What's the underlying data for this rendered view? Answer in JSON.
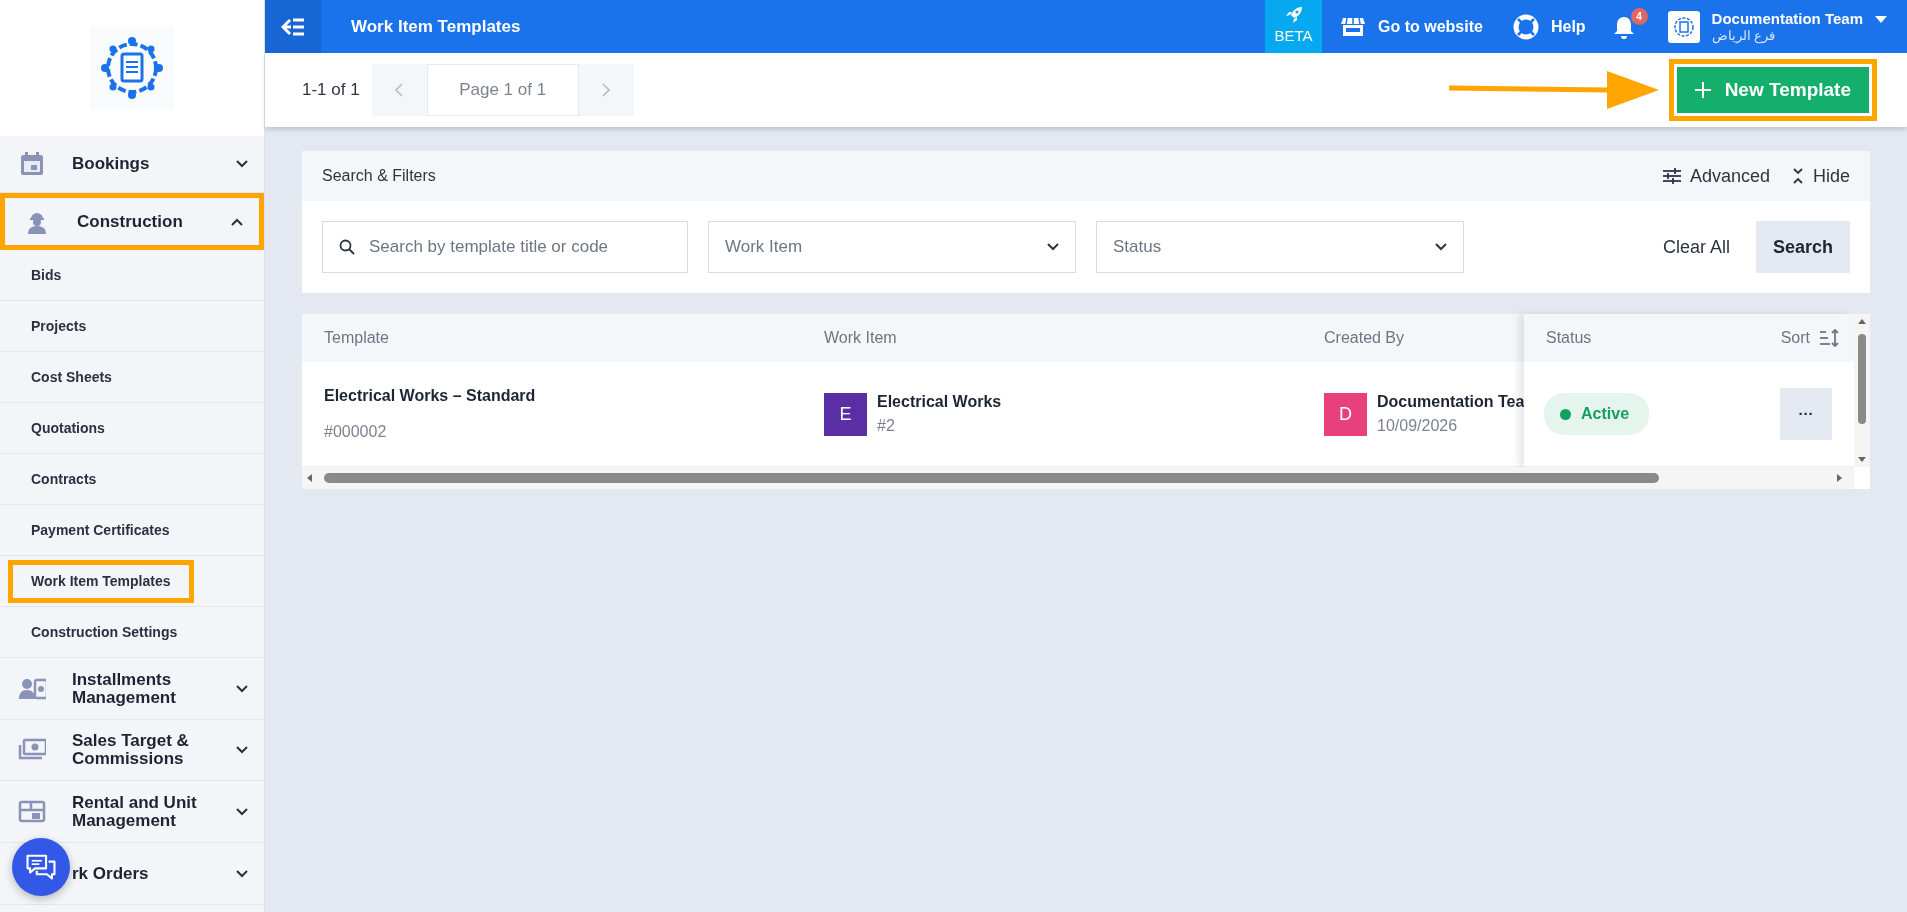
{
  "topbar": {
    "title": "Work Item Templates",
    "beta": "BETA",
    "links": [
      {
        "label": "Go to website"
      },
      {
        "label": "Help"
      }
    ],
    "notifications": "4",
    "account": {
      "name": "Documentation Team",
      "branch": "فرع الرياض"
    }
  },
  "sidebar": {
    "items": [
      {
        "label": "Bookings",
        "expanded": false,
        "highlighted": false
      },
      {
        "label": "Construction",
        "expanded": true,
        "highlighted": true,
        "children": [
          {
            "label": "Bids",
            "highlighted": false
          },
          {
            "label": "Projects",
            "highlighted": false
          },
          {
            "label": "Cost Sheets",
            "highlighted": false
          },
          {
            "label": "Quotations",
            "highlighted": false
          },
          {
            "label": "Contracts",
            "highlighted": false
          },
          {
            "label": "Payment Certificates",
            "highlighted": false
          },
          {
            "label": "Work Item Templates",
            "highlighted": true
          },
          {
            "label": "Construction Settings",
            "highlighted": false
          }
        ]
      },
      {
        "label": "Installments Management",
        "expanded": false,
        "highlighted": false
      },
      {
        "label": "Sales Target & Commissions",
        "expanded": false,
        "highlighted": false
      },
      {
        "label": "Rental and Unit Management",
        "expanded": false,
        "highlighted": false
      },
      {
        "label": "rk Orders",
        "expanded": false,
        "highlighted": false
      }
    ]
  },
  "toolbar": {
    "range": "1-1 of 1",
    "page": "Page 1 of 1",
    "new_button": {
      "label": "New Template",
      "highlighted": true
    }
  },
  "filters": {
    "title": "Search & Filters",
    "advanced": "Advanced",
    "hide": "Hide",
    "search": {
      "placeholder": "Search by template title or code"
    },
    "selects": [
      {
        "placeholder": "Work Item"
      },
      {
        "placeholder": "Status"
      }
    ],
    "clear": "Clear All",
    "submit": "Search"
  },
  "table": {
    "columns": [
      "Template",
      "Work Item",
      "Created By",
      "Status"
    ],
    "sort": "Sort",
    "rows": [
      {
        "template": "Electrical Works – Standard",
        "code": "#000002",
        "work_item": {
          "initial": "E",
          "name": "Electrical Works",
          "number": "#2",
          "color": "#5b2ea6"
        },
        "created_by": {
          "initial": "D",
          "name": "Documentation Tea",
          "date": "10/09/2026",
          "color": "#e8407a"
        },
        "status": {
          "label": "Active",
          "kind": "active"
        },
        "actions": "···"
      }
    ]
  }
}
